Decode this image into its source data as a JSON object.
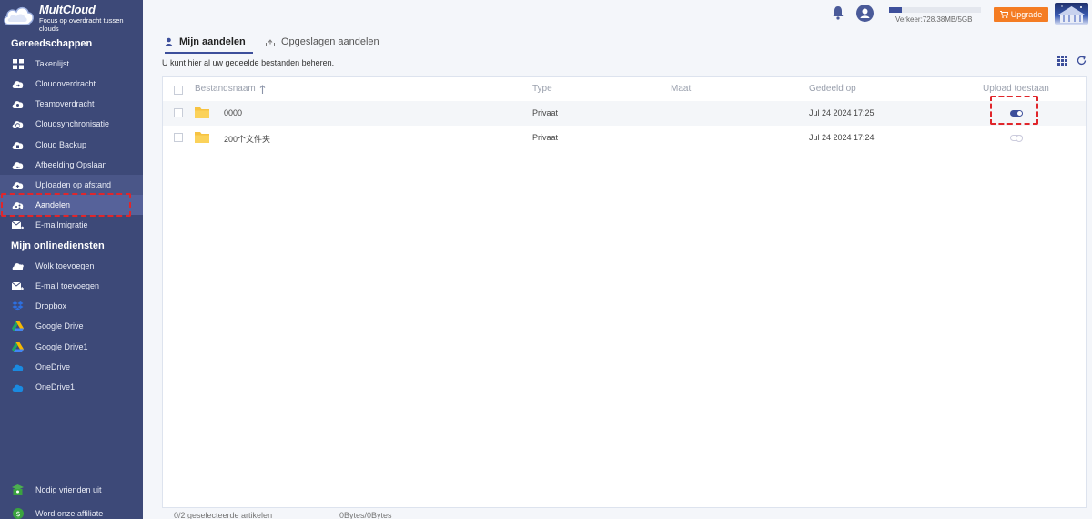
{
  "app": {
    "name": "MultCloud",
    "tagline": "Focus op overdracht tussen clouds"
  },
  "sidebar": {
    "tools_title": "Gereedschappen",
    "tools": [
      {
        "label": "Takenlijst",
        "icon": "task-list-icon"
      },
      {
        "label": "Cloudoverdracht",
        "icon": "cloud-transfer-icon"
      },
      {
        "label": "Teamoverdracht",
        "icon": "team-transfer-icon"
      },
      {
        "label": "Cloudsynchronisatie",
        "icon": "cloud-sync-icon"
      },
      {
        "label": "Cloud Backup",
        "icon": "cloud-backup-icon"
      },
      {
        "label": "Afbeelding Opslaan",
        "icon": "image-save-icon"
      },
      {
        "label": "Uploaden op afstand",
        "icon": "remote-upload-icon"
      },
      {
        "label": "Aandelen",
        "icon": "share-icon"
      },
      {
        "label": "E-mailmigratie",
        "icon": "email-migration-icon"
      }
    ],
    "services_title": "Mijn onlinediensten",
    "services": [
      {
        "label": "Wolk toevoegen",
        "icon": "add-cloud-icon"
      },
      {
        "label": "E-mail toevoegen",
        "icon": "add-email-icon"
      },
      {
        "label": "Dropbox",
        "icon": "dropbox-icon"
      },
      {
        "label": "Google Drive",
        "icon": "google-drive-icon"
      },
      {
        "label": "Google Drive1",
        "icon": "google-drive-icon"
      },
      {
        "label": "OneDrive",
        "icon": "onedrive-icon"
      },
      {
        "label": "OneDrive1",
        "icon": "onedrive-icon"
      }
    ],
    "bottom": [
      {
        "label": "Nodig vrienden uit",
        "icon": "invite-friends-icon"
      },
      {
        "label": "Word onze affiliate",
        "icon": "affiliate-icon"
      }
    ]
  },
  "topbar": {
    "traffic_label": "Verkeer:728.38MB/5GB",
    "traffic_fraction": 0.142,
    "upgrade_label": "Upgrade"
  },
  "tabs": [
    {
      "label": "Mijn aandelen",
      "active": true
    },
    {
      "label": "Opgeslagen aandelen",
      "active": false
    }
  ],
  "hint": "U kunt hier al uw gedeelde bestanden beheren.",
  "table": {
    "columns": {
      "name": "Bestandsnaam",
      "type": "Type",
      "size": "Maat",
      "shared": "Gedeeld op",
      "upload": "Upload toestaan"
    },
    "rows": [
      {
        "name": "0000",
        "type": "Privaat",
        "size": "",
        "shared": "Jul 24 2024 17:25",
        "upload_allowed": true
      },
      {
        "name": "200个文件夹",
        "type": "Privaat",
        "size": "",
        "shared": "Jul 24 2024 17:24",
        "upload_allowed": false
      }
    ]
  },
  "footer": {
    "selected": "0/2 geselecteerde artikelen",
    "bytes": "0Bytes/0Bytes"
  },
  "colors": {
    "sidebar_bg": "#3d4978",
    "accent": "#3d4f9b",
    "upgrade": "#f47c23",
    "annotation": "#e0262b",
    "folder": "#f7c342"
  }
}
